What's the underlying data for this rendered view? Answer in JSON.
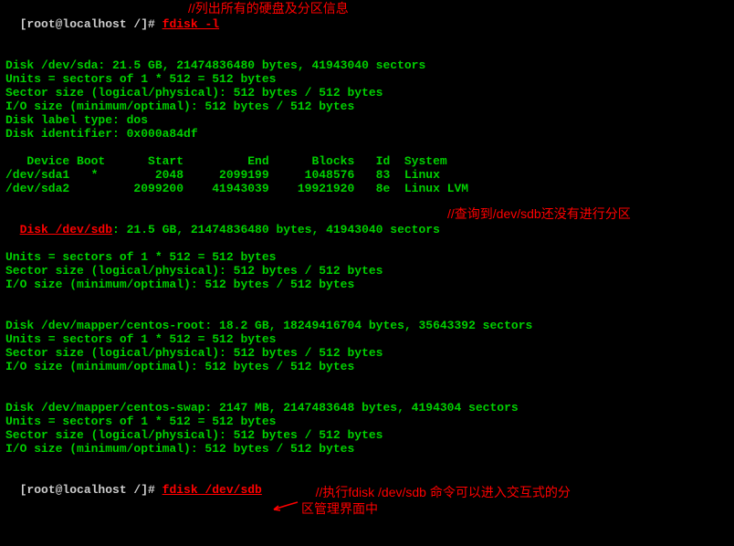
{
  "prompt1": {
    "prefix": "[root@localhost /]# ",
    "cmd": "fdisk -l"
  },
  "anno1": "//列出所有的硬盘及分区信息",
  "sda": {
    "l1": "Disk /dev/sda: 21.5 GB, 21474836480 bytes, 41943040 sectors",
    "l2": "Units = sectors of 1 * 512 = 512 bytes",
    "l3": "Sector size (logical/physical): 512 bytes / 512 bytes",
    "l4": "I/O size (minimum/optimal): 512 bytes / 512 bytes",
    "l5": "Disk label type: dos",
    "l6": "Disk identifier: 0x000a84df"
  },
  "table": {
    "hdr": "   Device Boot      Start         End      Blocks   Id  System",
    "r1": "/dev/sda1   *        2048     2099199     1048576   83  Linux",
    "r2": "/dev/sda2         2099200    41943039    19921920   8e  Linux LVM"
  },
  "sdb": {
    "l1a": "Disk /dev/sdb",
    "l1b": ": 21.5 GB, 21474836480 bytes, 41943040 sectors",
    "l2": "Units = sectors of 1 * 512 = 512 bytes",
    "l3": "Sector size (logical/physical): 512 bytes / 512 bytes",
    "l4": "I/O size (minimum/optimal): 512 bytes / 512 bytes"
  },
  "anno2": "//查询到/dev/sdb还没有进行分区",
  "root": {
    "l1": "Disk /dev/mapper/centos-root: 18.2 GB, 18249416704 bytes, 35643392 sectors",
    "l2": "Units = sectors of 1 * 512 = 512 bytes",
    "l3": "Sector size (logical/physical): 512 bytes / 512 bytes",
    "l4": "I/O size (minimum/optimal): 512 bytes / 512 bytes"
  },
  "swap": {
    "l1": "Disk /dev/mapper/centos-swap: 2147 MB, 2147483648 bytes, 4194304 sectors",
    "l2": "Units = sectors of 1 * 512 = 512 bytes",
    "l3": "Sector size (logical/physical): 512 bytes / 512 bytes",
    "l4": "I/O size (minimum/optimal): 512 bytes / 512 bytes"
  },
  "prompt2": {
    "prefix": "[root@localhost /]# ",
    "cmd": "fdisk /dev/sdb"
  },
  "anno3a": "//执行fdisk /dev/sdb 命令可以进入交互式的分",
  "anno3b": "区管理界面中"
}
